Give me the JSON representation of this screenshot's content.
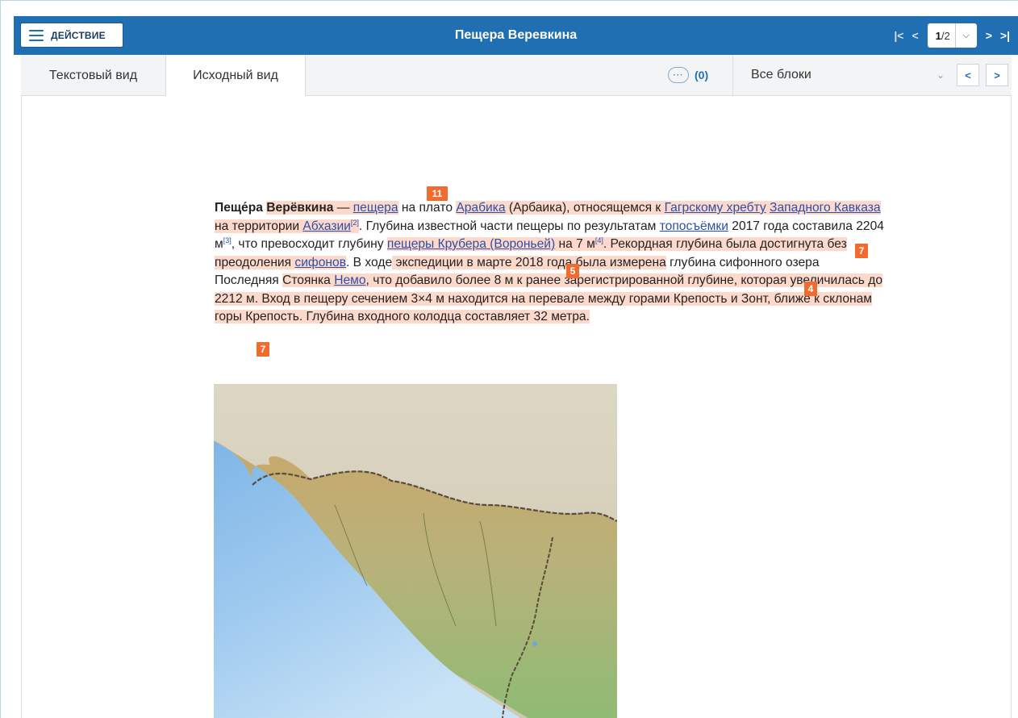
{
  "toolbar": {
    "action_label": "ДЕЙСТВИЕ",
    "document_title": "Пещера Веревкина",
    "page_current": "1",
    "page_total": "/2"
  },
  "tabs": {
    "text_view": "Текстовый вид",
    "source_view": "Исходный вид"
  },
  "comments": {
    "count": "(0)",
    "icon": "comment-bubble-icon"
  },
  "blocks": {
    "selected": "Все блоки"
  },
  "article": {
    "t_title_a": "Пеще́ра",
    "t_title_b": "Верёвкина",
    "t_dash": " — ",
    "l_peshchera": "пещера",
    "t_plato": " на плато ",
    "l_arabika": "Арабика",
    "t_arbaika": " (Арбаика), относящемся к ",
    "l_gagrskomu": "Гагрскому хребту",
    "l_zapkavkaz": "Западного Кавказа",
    "t_territory": " на территории ",
    "l_abkhazia": "Абхазии",
    "s_2": "[2]",
    "t_glubina": ". Глубина известной части пещеры по результатам ",
    "l_toposemki": "топосъёмки",
    "t_2017": " 2017 года составила 2204 м",
    "s_3": "[3]",
    "t_prevos": ", что превосходит глубину ",
    "l_krubera": "пещеры Крубера (Вороньей)",
    "t_7m": " на 7 м",
    "s_4": "[4]",
    "t_rekord": ". Рекордная глубина была достигнута без преодоления ",
    "l_sifonov": "сифонов",
    "t_v": ". В",
    "t_khode": "ходе",
    "t_ekspedicii": " экспедиции в марте 2018 года была измерена",
    "t_sifonnogo": " глубина сифонного озера Последняя",
    "t_stoyanka": "Стоянка ",
    "l_nemo": "Немо",
    "t_dobavilo": ", что добавило более 8 м к ранее зарегистрированной глубине, которая увеличилась до 2212 м.",
    "t_vkhod": " Вход в пещеру сечением 3×4 м находится на перевале между горами Крепость и Зонт, ближе к склонам горы Крепость. Глубина входного колодца составляет 32 метра."
  },
  "markers": {
    "m1": "11",
    "m2": "7",
    "m3": "5",
    "m4": "4",
    "m5": "7"
  },
  "colors": {
    "header_blue": "#1f6fb2",
    "highlight": "#fdd9cc",
    "marker": "#ef6b2e"
  }
}
